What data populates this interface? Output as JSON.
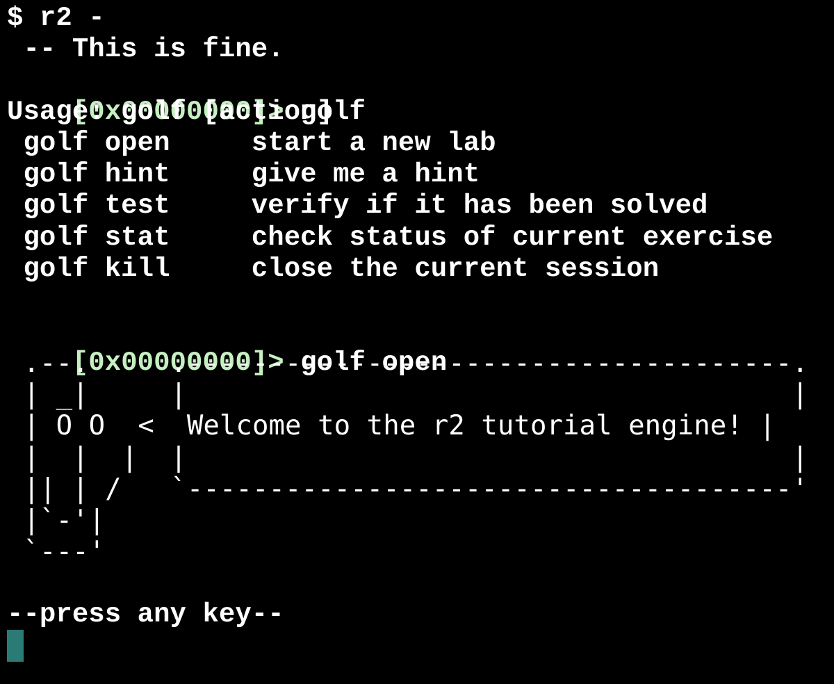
{
  "terminal": {
    "lines": {
      "l0": "$ r2 -",
      "l1": " -- This is fine.",
      "l2_prompt": "[0x00000000]>",
      "l2_cmd": " golf",
      "l3": "Usage: golf [action]",
      "l4": " golf open     start a new lab",
      "l5": " golf hint     give me a hint",
      "l6": " golf test     verify if it has been solved",
      "l7": " golf stat     check status of current exercise",
      "l8": " golf kill     close the current session",
      "l10_prompt": "[0x00000000]>",
      "l10_cmd": " golf open",
      "art1": " .--.     .-------------------------------------.",
      "art2": " | _|     |                                     |",
      "art3": " | O O  <  Welcome to the r2 tutorial engine! |",
      "art4": " |  |  |  |                                     |",
      "art5": " || | /   `-------------------------------------'",
      "art6": " |`-'|",
      "art7": " `---'",
      "l18": "--press any key--"
    },
    "colors": {
      "background": "#000000",
      "text": "#ffffff",
      "prompt": "#c6f0c2",
      "cursor": "#2a7b74"
    }
  }
}
